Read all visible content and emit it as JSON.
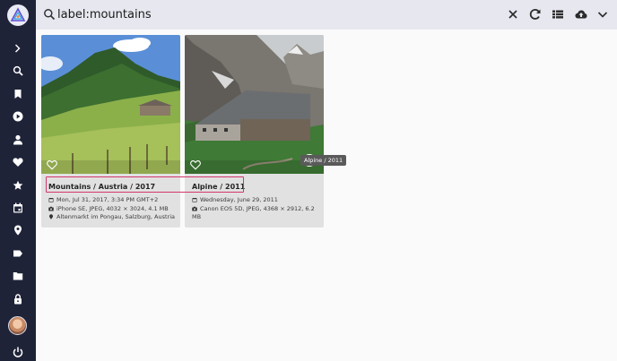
{
  "search": {
    "query": "label:mountains"
  },
  "sidebar": {
    "items": [
      {
        "name": "expand",
        "icon": "chevron-right-icon"
      },
      {
        "name": "search",
        "icon": "search-icon"
      },
      {
        "name": "albums",
        "icon": "bookmark-icon"
      },
      {
        "name": "videos",
        "icon": "play-circle-icon"
      },
      {
        "name": "people",
        "icon": "person-icon"
      },
      {
        "name": "favorites",
        "icon": "heart-icon"
      },
      {
        "name": "moments",
        "icon": "star-icon"
      },
      {
        "name": "calendar",
        "icon": "calendar-icon"
      },
      {
        "name": "places",
        "icon": "location-pin-icon"
      },
      {
        "name": "labels",
        "icon": "label-tag-icon"
      },
      {
        "name": "folders",
        "icon": "folder-icon"
      },
      {
        "name": "private",
        "icon": "lock-icon"
      },
      {
        "name": "account",
        "icon": "avatar"
      },
      {
        "name": "logout",
        "icon": "power-icon"
      }
    ]
  },
  "toolbar": {
    "icons": [
      "close-icon",
      "refresh-icon",
      "view-list-icon",
      "upload-cloud-icon",
      "chevron-down-icon"
    ]
  },
  "cards": [
    {
      "title": "Mountains / Austria / 2017",
      "date": "Mon, Jul 31, 2017, 3:34 PM GMT+2",
      "camera": "iPhone SE, JPEG, 4032 × 3024, 4.1 MB",
      "location": "Altenmarkt im Pongau, Salzburg, Austria"
    },
    {
      "title": "Alpine / 2011",
      "date": "Wednesday, June 29, 2011",
      "camera_line1": "Canon EOS 5D, JPEG, 4368 × 2912, 6.2",
      "camera_line2": "MB",
      "tooltip": "Alpine / 2011"
    }
  ],
  "colors": {
    "sidebar_bg": "#1f2338",
    "topbar_bg": "#e6e7ef",
    "card_bg": "#e1e1e1",
    "highlight": "#d4366b"
  }
}
